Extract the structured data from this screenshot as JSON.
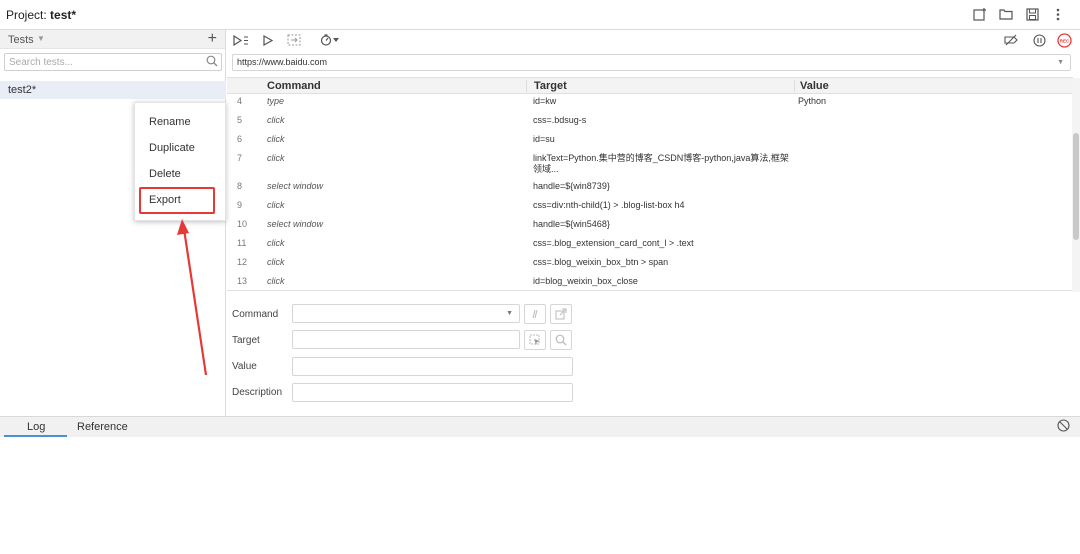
{
  "project": {
    "label": "Project:",
    "name": "test*"
  },
  "header_icons": [
    "new-project-icon",
    "open-project-icon",
    "save-project-icon",
    "more-options-icon"
  ],
  "tests_panel": {
    "title": "Tests",
    "add_label": "+",
    "search_placeholder": "Search tests...",
    "items": [
      {
        "label": "test2*"
      }
    ]
  },
  "context_menu": {
    "items": [
      {
        "label": "Rename"
      },
      {
        "label": "Duplicate"
      },
      {
        "label": "Delete"
      },
      {
        "label": "Export"
      }
    ],
    "highlighted": "Export"
  },
  "toolbar": {
    "left_icons": [
      "run-all-tests-icon",
      "run-current-test-icon",
      "step-over-icon",
      "speed-icon"
    ],
    "right_icons": [
      "disable-breakpoints-icon",
      "pause-icon",
      "record-icon"
    ],
    "record_label": "REC"
  },
  "url": {
    "value": "https://www.baidu.com"
  },
  "grid": {
    "columns": [
      "Command",
      "Target",
      "Value"
    ],
    "rows": [
      {
        "num": "4",
        "command": "type",
        "target": "id=kw",
        "value": "Python"
      },
      {
        "num": "5",
        "command": "click",
        "target": "css=.bdsug-s",
        "value": ""
      },
      {
        "num": "6",
        "command": "click",
        "target": "id=su",
        "value": ""
      },
      {
        "num": "7",
        "command": "click",
        "target": "linkText=Python.集中营的博客_CSDN博客-python,java算法,框架领域...",
        "value": ""
      },
      {
        "num": "8",
        "command": "select window",
        "target": "handle=${win8739}",
        "value": ""
      },
      {
        "num": "9",
        "command": "click",
        "target": "css=div:nth-child(1) > .blog-list-box h4",
        "value": ""
      },
      {
        "num": "10",
        "command": "select window",
        "target": "handle=${win5468}",
        "value": ""
      },
      {
        "num": "11",
        "command": "click",
        "target": "css=.blog_extension_card_cont_l > .text",
        "value": ""
      },
      {
        "num": "12",
        "command": "click",
        "target": "css=.blog_weixin_box_btn > span",
        "value": ""
      },
      {
        "num": "13",
        "command": "click",
        "target": "id=blog_weixin_box_close",
        "value": ""
      }
    ]
  },
  "editor": {
    "command_label": "Command",
    "target_label": "Target",
    "value_label": "Value",
    "description_label": "Description",
    "command_value": "",
    "target_value": "",
    "value_value": "",
    "description_value": ""
  },
  "bottom_tabs": {
    "log": "Log",
    "reference": "Reference",
    "active": "Log"
  },
  "colors": {
    "highlight_red": "#e53935",
    "accent_blue": "#4a90d9",
    "record_red": "#e53935"
  }
}
